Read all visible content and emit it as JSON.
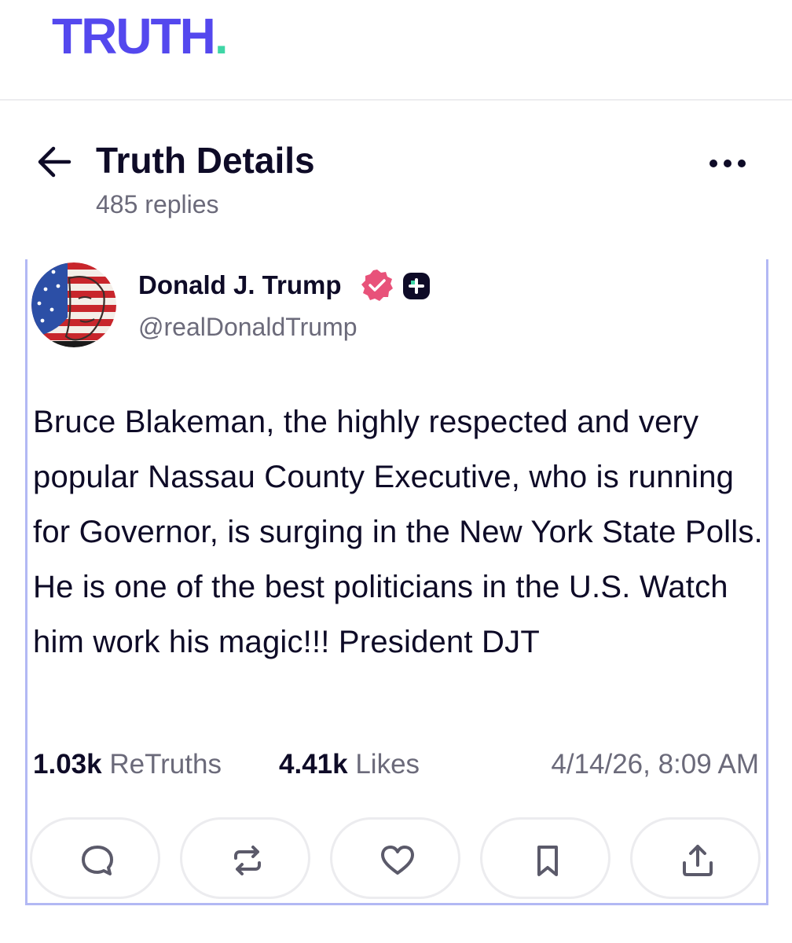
{
  "app": {
    "logo_text": "TRUTH",
    "logo_dot": ".",
    "brand_color": "#5448ee",
    "dot_color": "#3fd6a6"
  },
  "header": {
    "title": "Truth Details",
    "replies": "485 replies",
    "back_icon": "arrow-left-icon",
    "more_icon": "more-horizontal-icon"
  },
  "post": {
    "author_name": "Donald J. Trump",
    "handle": "@realDonaldTrump",
    "verified_color": "#e8527a",
    "body": "Bruce Blakeman, the highly respected and very popular Nassau County Executive, who is running for Governor, is surging in the New York State Polls. He is one of the best politicians in the U.S. Watch him work his magic!!! President DJT",
    "stats": {
      "retruths_count": "1.03k",
      "retruths_label": "ReTruths",
      "likes_count": "4.41k",
      "likes_label": "Likes",
      "timestamp": "4/14/26, 8:09 AM"
    },
    "actions": [
      {
        "icon": "reply-icon"
      },
      {
        "icon": "retruth-icon"
      },
      {
        "icon": "like-icon"
      },
      {
        "icon": "bookmark-icon"
      },
      {
        "icon": "share-icon"
      }
    ]
  }
}
